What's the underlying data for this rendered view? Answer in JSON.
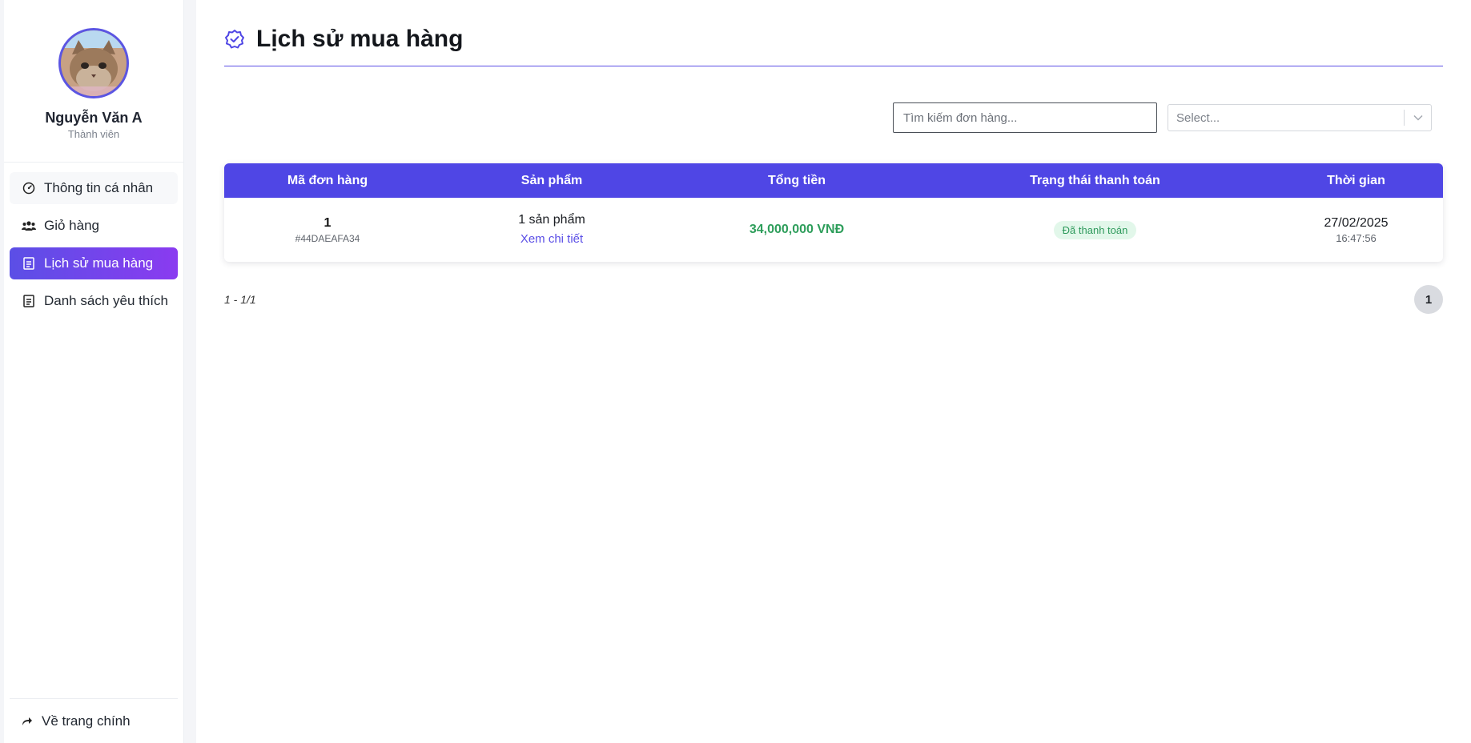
{
  "user": {
    "name": "Nguyễn Văn A",
    "role": "Thành viên"
  },
  "sidebar": {
    "items": [
      {
        "label": "Thông tin cá nhân",
        "icon": "dashboard-gauge-icon"
      },
      {
        "label": "Giỏ hàng",
        "icon": "users-group-icon"
      },
      {
        "label": "Lịch sử mua hàng",
        "icon": "document-icon",
        "active": true
      },
      {
        "label": "Danh sách yêu thích",
        "icon": "document-icon"
      }
    ],
    "footer_label": "Về trang chính",
    "footer_icon": "share-arrow-icon"
  },
  "page": {
    "title": "Lịch sử mua hàng",
    "title_icon": "badge-check-icon"
  },
  "filters": {
    "search_placeholder": "Tìm kiếm đơn hàng...",
    "select_placeholder": "Select..."
  },
  "table": {
    "headers": [
      "Mã đơn hàng",
      "Sản phẩm",
      "Tổng tiền",
      "Trạng thái thanh toán",
      "Thời gian"
    ],
    "rows": [
      {
        "order_number": "1",
        "order_code": "#44DAEAFA34",
        "product_count": "1 sản phẩm",
        "detail_link": "Xem chi tiết",
        "total": "34,000,000 VNĐ",
        "status": "Đã thanh toán",
        "date": "27/02/2025",
        "time": "16:47:56"
      }
    ]
  },
  "pagination": {
    "range": "1 - 1/1",
    "current_page": "1"
  },
  "colors": {
    "accent": "#4f46e5",
    "active_gradient_end": "#8a3bf0",
    "paid_green": "#2e9e5b",
    "paid_badge_bg": "#e2f7ea"
  }
}
